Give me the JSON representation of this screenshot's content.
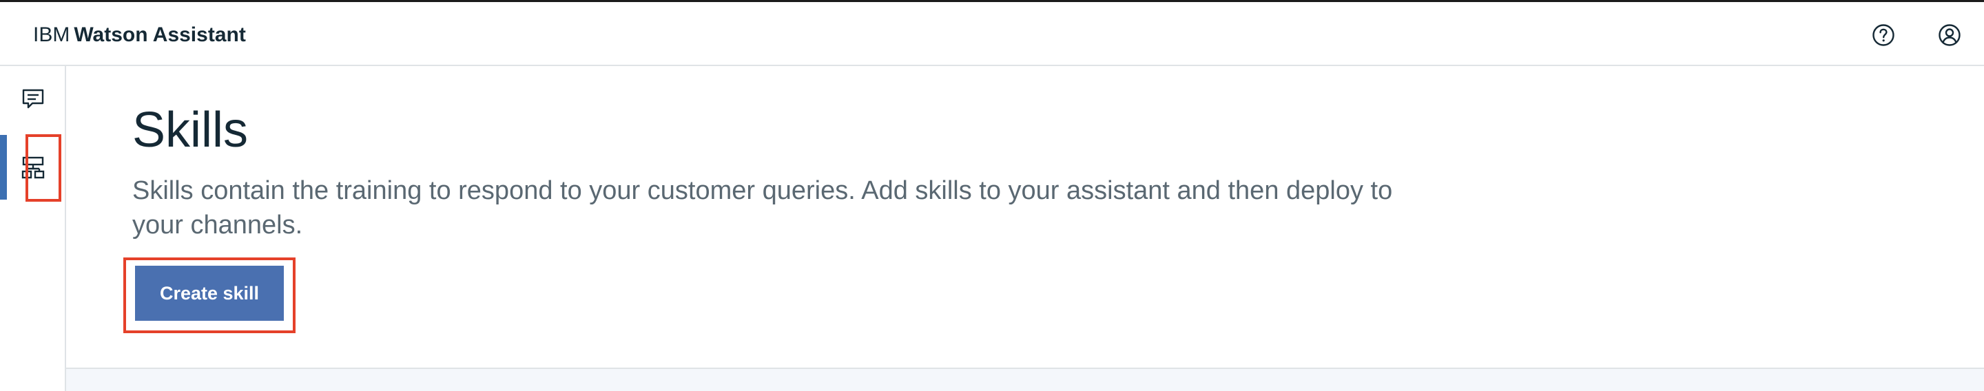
{
  "header": {
    "brand_prefix": "IBM",
    "brand_product": "Watson Assistant",
    "icons": {
      "help": "help-icon",
      "user": "user-avatar-icon"
    }
  },
  "sidenav": {
    "items": [
      {
        "id": "assistants",
        "icon": "chat-bubble-icon",
        "active": false
      },
      {
        "id": "skills",
        "icon": "skills-tree-icon",
        "active": true
      }
    ]
  },
  "main": {
    "title": "Skills",
    "description": "Skills contain the training to respond to your customer queries. Add skills to your assistant and then deploy to your channels.",
    "create_button_label": "Create skill"
  },
  "colors": {
    "accent": "#3d70b2",
    "button": "#4a70b0",
    "highlight": "#e5412a",
    "text_dark": "#152935",
    "text_muted": "#5a6872"
  }
}
